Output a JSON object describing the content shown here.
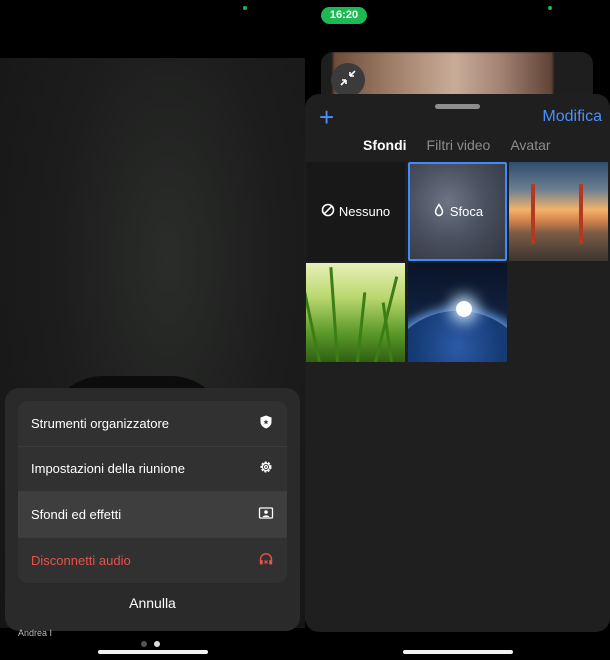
{
  "left": {
    "speaker_name": "Andrea I",
    "action_sheet": {
      "items": [
        {
          "label": "Strumenti organizzatore",
          "icon": "shield-icon"
        },
        {
          "label": "Impostazioni della riunione",
          "icon": "gear-icon"
        },
        {
          "label": "Sfondi ed effetti",
          "icon": "portrait-icon"
        },
        {
          "label": "Disconnetti audio",
          "icon": "headphones-x-icon"
        }
      ],
      "selected_index": 2,
      "danger_index": 3,
      "cancel_label": "Annulla"
    },
    "page_indicator": {
      "count": 2,
      "active": 1
    }
  },
  "right": {
    "status_time": "16:20",
    "panel": {
      "add_label": "+",
      "edit_label": "Modifica",
      "tabs": [
        {
          "label": "Sfondi",
          "active": true
        },
        {
          "label": "Filtri video",
          "active": false
        },
        {
          "label": "Avatar",
          "active": false
        }
      ],
      "tiles": [
        {
          "label": "Nessuno",
          "icon": "no-entry-icon",
          "kind": "none"
        },
        {
          "label": "Sfoca",
          "icon": "droplet-icon",
          "kind": "blur",
          "selected": true
        },
        {
          "label": "",
          "kind": "golden-gate-bridge"
        },
        {
          "label": "",
          "kind": "grass"
        },
        {
          "label": "",
          "kind": "earth-from-space"
        }
      ]
    }
  },
  "colors": {
    "accent_blue": "#4a8eff",
    "danger_red": "#e5534b",
    "status_green": "#1db954"
  }
}
